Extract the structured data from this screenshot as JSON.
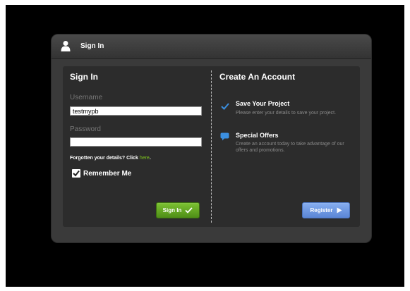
{
  "dialog": {
    "title": "Sign In"
  },
  "signin": {
    "heading": "Sign In",
    "username_label": "Username",
    "username_value": "testmypb",
    "password_label": "Password",
    "password_value": "",
    "forgot_text": "Forgotten your details? Click",
    "forgot_link": "here",
    "forgot_suffix": ".",
    "remember_label": "Remember Me",
    "remember_checked": true,
    "button_label": "Sign In"
  },
  "create": {
    "heading": "Create An Account",
    "features": [
      {
        "icon": "checkmark-icon",
        "title": "Save Your Project",
        "desc": "Please enter your details to save your project."
      },
      {
        "icon": "speech-bubble-icon",
        "title": "Special Offers",
        "desc": "Create an account today to take advantage of our offers and promotions."
      }
    ],
    "button_label": "Register"
  },
  "colors": {
    "accent_green": "#6bb324",
    "accent_blue": "#6f9be6",
    "check_blue": "#3b8fe0"
  }
}
